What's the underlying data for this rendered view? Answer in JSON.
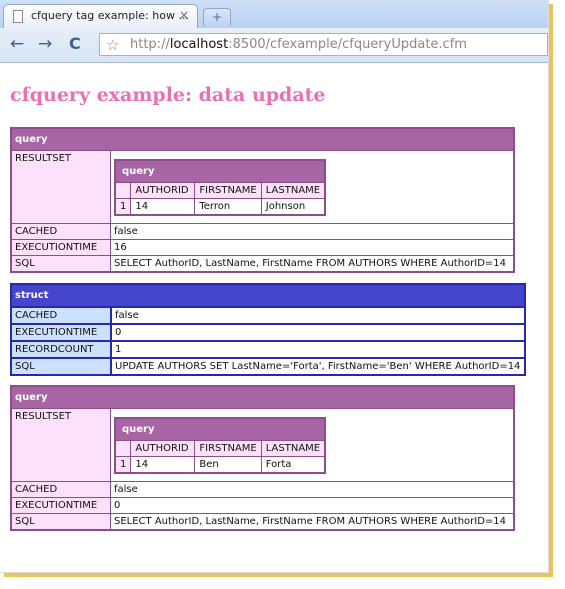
{
  "browser": {
    "tab_title": "cfquery tag example: how ...",
    "tab_close": "×",
    "new_tab": "+",
    "back": "←",
    "forward": "→",
    "reload": "C",
    "star": "☆",
    "url_scheme": "http://",
    "url_host": "localhost",
    "url_rest": ":8500/cfexample/cfqueryUpdate.cfm"
  },
  "page": {
    "heading": "cfquery example: data update"
  },
  "dump1": {
    "type": "query",
    "resultset_label": "RESULTSET",
    "inner": {
      "type": "query",
      "columns": [
        "AUTHORID",
        "FIRSTNAME",
        "LASTNAME"
      ],
      "row_num": "1",
      "row": [
        "14",
        "Terron",
        "Johnson"
      ]
    },
    "cached_label": "CACHED",
    "cached": "false",
    "exectime_label": "EXECUTIONTIME",
    "exectime": "16",
    "sql_label": "SQL",
    "sql": "SELECT AuthorID, LastName, FirstName FROM AUTHORS WHERE AuthorID=14"
  },
  "dump2": {
    "type": "struct",
    "cached_label": "CACHED",
    "cached": "false",
    "exectime_label": "EXECUTIONTIME",
    "exectime": "0",
    "recordcount_label": "RECORDCOUNT",
    "recordcount": "1",
    "sql_label": "SQL",
    "sql": "UPDATE AUTHORS SET LastName='Forta', FirstName='Ben' WHERE AuthorID=14"
  },
  "dump3": {
    "type": "query",
    "resultset_label": "RESULTSET",
    "inner": {
      "type": "query",
      "columns": [
        "AUTHORID",
        "FIRSTNAME",
        "LASTNAME"
      ],
      "row_num": "1",
      "row": [
        "14",
        "Ben",
        "Forta"
      ]
    },
    "cached_label": "CACHED",
    "cached": "false",
    "exectime_label": "EXECUTIONTIME",
    "exectime": "0",
    "sql_label": "SQL",
    "sql": "SELECT AuthorID, LastName, FirstName FROM AUTHORS WHERE AuthorID=14"
  }
}
